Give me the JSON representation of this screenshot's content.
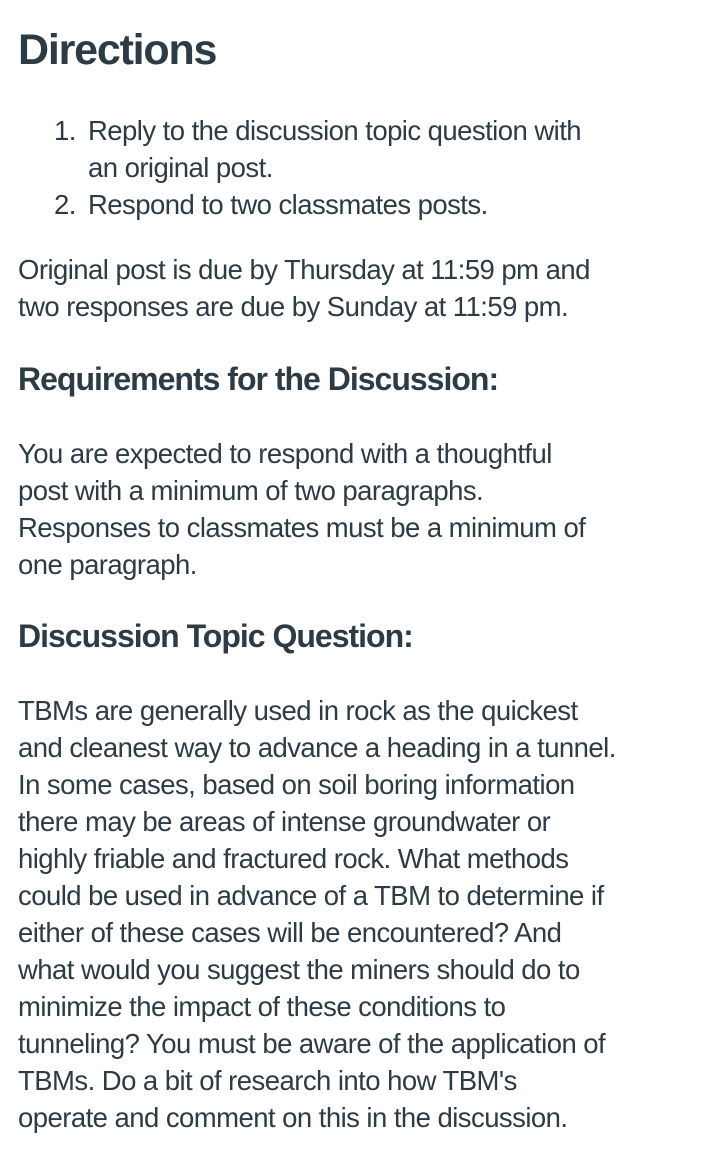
{
  "directions": {
    "title": "Directions",
    "steps": [
      {
        "number": "1.",
        "lines": [
          "Reply to the discussion topic question with",
          "an original post."
        ]
      },
      {
        "number": "2.",
        "lines": [
          "Respond to two classmates posts."
        ]
      }
    ],
    "due_text_lines": [
      "Original post is due by Thursday at 11:59 pm and",
      "two responses are due by Sunday at 11:59 pm."
    ]
  },
  "requirements": {
    "title": "Requirements for the Discussion:",
    "text_lines": [
      "You are expected to respond with a thoughtful",
      "post with a minimum of two paragraphs.",
      "Responses to classmates must be a minimum of",
      "one paragraph."
    ]
  },
  "topic": {
    "title": "Discussion Topic Question:",
    "text_lines": [
      "TBMs are generally used in rock as the quickest",
      "and cleanest way to advance a heading in a tunnel.",
      "In some cases, based on soil boring information",
      "there may be areas of intense groundwater or",
      "highly friable and fractured rock. What methods",
      "could be used in advance of a TBM to determine if",
      "either of these cases will be encountered? And",
      "what would you suggest the miners should do to",
      "minimize the impact of these conditions to",
      "tunneling? You must be aware of the application of",
      "TBMs. Do a bit of research into how TBM's",
      "operate and comment on this in the discussion."
    ]
  },
  "colors": {
    "text": "#2d3b45",
    "background": "#ffffff"
  }
}
